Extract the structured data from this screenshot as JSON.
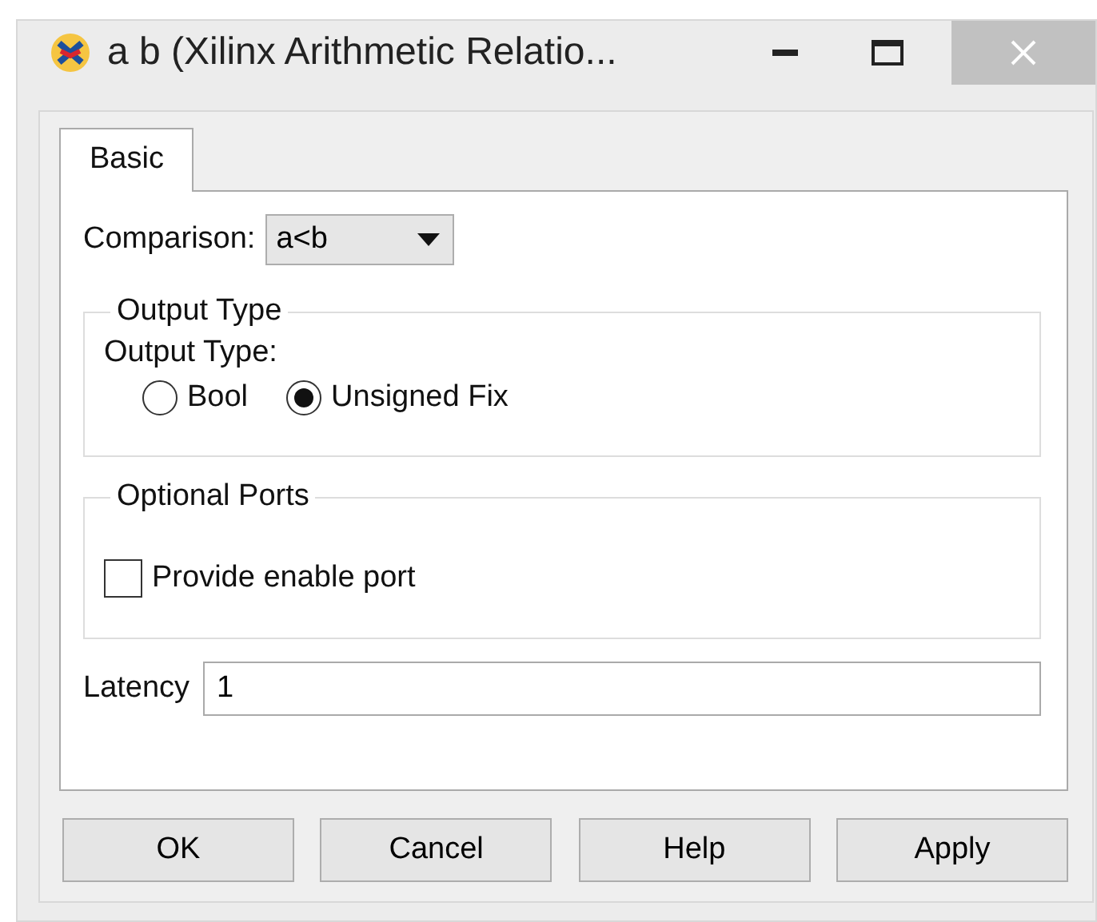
{
  "window": {
    "title": "a b (Xilinx Arithmetic Relatio..."
  },
  "tabs": [
    {
      "label": "Basic",
      "selected": true
    }
  ],
  "comparison": {
    "label": "Comparison:",
    "value": "a<b"
  },
  "output_type": {
    "title": "Output Type",
    "label": "Output Type:",
    "options": [
      {
        "label": "Bool",
        "selected": false
      },
      {
        "label": "Unsigned Fix",
        "selected": true
      }
    ]
  },
  "optional_ports": {
    "title": "Optional Ports",
    "checkbox": {
      "label": "Provide enable port",
      "checked": false
    }
  },
  "latency": {
    "label": "Latency",
    "value": "1"
  },
  "buttons": [
    "OK",
    "Cancel",
    "Help",
    "Apply"
  ]
}
